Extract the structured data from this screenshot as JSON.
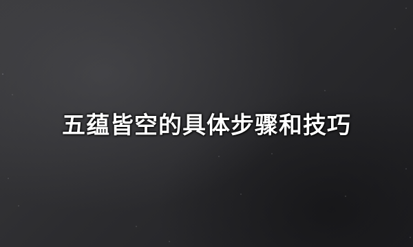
{
  "title": "五蕴皆空的具体步骤和技巧",
  "background_color": "#2a2a2c",
  "title_color": "#ffffff"
}
